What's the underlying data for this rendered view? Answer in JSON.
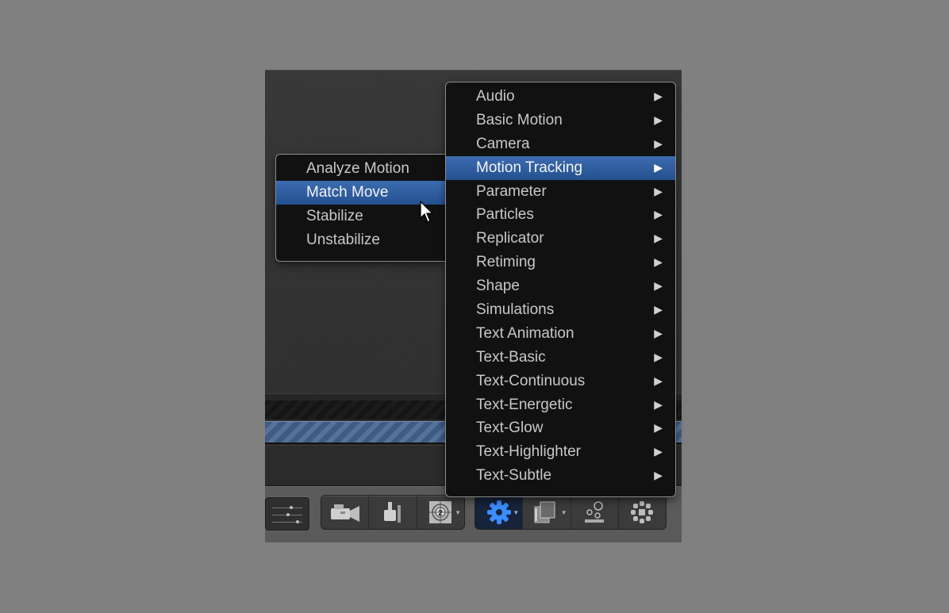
{
  "main_menu": {
    "items": [
      {
        "label": "Audio",
        "submenu": true,
        "selected": false
      },
      {
        "label": "Basic Motion",
        "submenu": true,
        "selected": false
      },
      {
        "label": "Camera",
        "submenu": true,
        "selected": false
      },
      {
        "label": "Motion Tracking",
        "submenu": true,
        "selected": true
      },
      {
        "label": "Parameter",
        "submenu": true,
        "selected": false
      },
      {
        "label": "Particles",
        "submenu": true,
        "selected": false
      },
      {
        "label": "Replicator",
        "submenu": true,
        "selected": false
      },
      {
        "label": "Retiming",
        "submenu": true,
        "selected": false
      },
      {
        "label": "Shape",
        "submenu": true,
        "selected": false
      },
      {
        "label": "Simulations",
        "submenu": true,
        "selected": false
      },
      {
        "label": "Text Animation",
        "submenu": true,
        "selected": false
      },
      {
        "label": "Text-Basic",
        "submenu": true,
        "selected": false
      },
      {
        "label": "Text-Continuous",
        "submenu": true,
        "selected": false
      },
      {
        "label": "Text-Energetic",
        "submenu": true,
        "selected": false
      },
      {
        "label": "Text-Glow",
        "submenu": true,
        "selected": false
      },
      {
        "label": "Text-Highlighter",
        "submenu": true,
        "selected": false
      },
      {
        "label": "Text-Subtle",
        "submenu": true,
        "selected": false
      }
    ],
    "arrow_glyph": "▶"
  },
  "sub_menu": {
    "items": [
      {
        "label": "Analyze Motion",
        "selected": false
      },
      {
        "label": "Match Move",
        "selected": true
      },
      {
        "label": "Stabilize",
        "selected": false
      },
      {
        "label": "Unstabilize",
        "selected": false
      }
    ]
  },
  "toolbar": {
    "group1": [
      {
        "icon": "video-camera-icon"
      },
      {
        "icon": "lighting-icon"
      },
      {
        "icon": "countdown-icon",
        "dropdown": true,
        "number": "2"
      }
    ],
    "group2": [
      {
        "icon": "behaviors-gear-icon",
        "dropdown": true,
        "active": true
      },
      {
        "icon": "filters-icon",
        "dropdown": true
      },
      {
        "icon": "particles-icon"
      },
      {
        "icon": "replicator-icon"
      }
    ]
  },
  "colors": {
    "selection": "#2e5a9c",
    "active_icon": "#3b8cff"
  }
}
